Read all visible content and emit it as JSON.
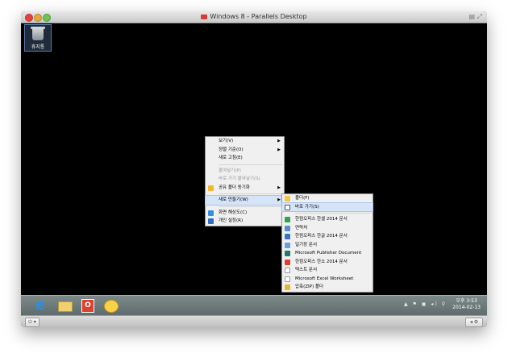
{
  "window": {
    "title": "Windows 8 - Parallels Desktop"
  },
  "desktop": {
    "recycle_bin_label": "휴지통"
  },
  "context_menu": {
    "items": [
      {
        "label": "보기(V)",
        "submenu": true
      },
      {
        "label": "정렬 기준(O)",
        "submenu": true
      },
      {
        "label": "새로 고침(E)"
      },
      {
        "label": "붙여넣기(P)",
        "disabled": true
      },
      {
        "label": "바로 가기 붙여넣기(S)",
        "disabled": true
      },
      {
        "label": "공유 폴더 동기화",
        "submenu": true,
        "icon": "sync-icon"
      },
      {
        "label": "새로 만들기(W)",
        "submenu": true,
        "highlighted": true
      },
      {
        "label": "화면 해상도(C)",
        "icon": "display-icon"
      },
      {
        "label": "개인 설정(R)",
        "icon": "personalize-icon"
      }
    ]
  },
  "new_submenu": {
    "items": [
      {
        "label": "폴더(F)",
        "icon": "folder-icon"
      },
      {
        "label": "바로 가기(S)",
        "icon": "shortcut-icon",
        "highlighted": true
      },
      {
        "label": "한컴오피스 한셀 2014 문서",
        "icon": "hancell-icon"
      },
      {
        "label": "연락처",
        "icon": "contact-icon"
      },
      {
        "label": "한컴오피스 한글 2014 문서",
        "icon": "hangul-icon"
      },
      {
        "label": "일기장 문서",
        "icon": "journal-icon"
      },
      {
        "label": "Microsoft Publisher Document",
        "icon": "publisher-icon"
      },
      {
        "label": "한컴오피스 한쇼 2014 문서",
        "icon": "hanshow-icon"
      },
      {
        "label": "텍스트 문서",
        "icon": "text-doc-icon"
      },
      {
        "label": "Microsoft Excel Worksheet",
        "icon": "excel-icon"
      },
      {
        "label": "압축(ZIP) 폴더",
        "icon": "zip-folder-icon"
      }
    ]
  },
  "taskbar": {
    "clock_period_time": "오후 3:53",
    "clock_date": "2014-02-13",
    "tray": "▲ ⚑ ▣ ◂) ⚲"
  },
  "bottom_bar": {
    "power_label": "⏻ ▾",
    "right_label": "◂  ⚙"
  }
}
